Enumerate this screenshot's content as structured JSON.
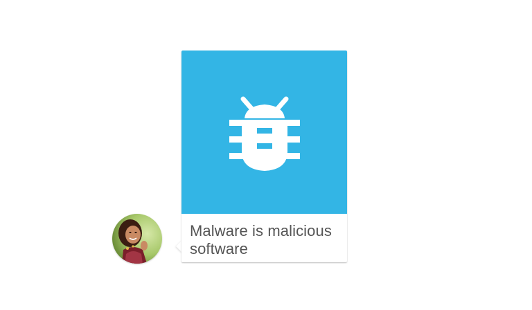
{
  "message": {
    "caption": "Malware is malicious software",
    "image_icon": "bug-icon",
    "image_background": "#33b5e5"
  },
  "sender": {
    "avatar_icon": "avatar-photo"
  }
}
